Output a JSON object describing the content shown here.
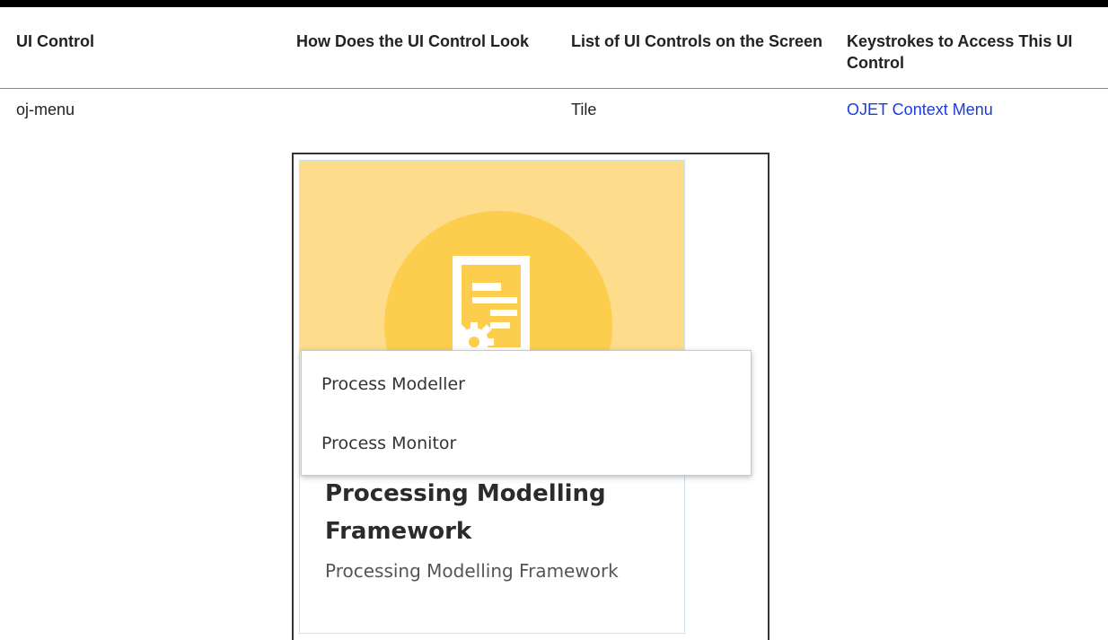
{
  "table": {
    "headers": [
      "UI Control",
      "How Does the UI Control Look",
      "List of UI Controls on the Screen",
      "Keystrokes to Access This UI Control"
    ],
    "row": {
      "control": "oj-menu",
      "screen_control": "Tile",
      "keystroke_link": "OJET Context Menu"
    }
  },
  "screenshot": {
    "tile_icon": "document-gear-icon",
    "tile_title": "Processing Modelling Framework",
    "tile_description": "Processing Modelling Framework",
    "menu_items": [
      "Process Modeller",
      "Process Monitor"
    ]
  },
  "colors": {
    "banner": "#fddc8c",
    "circle": "#fdce4e",
    "link": "#1a3ddb"
  }
}
